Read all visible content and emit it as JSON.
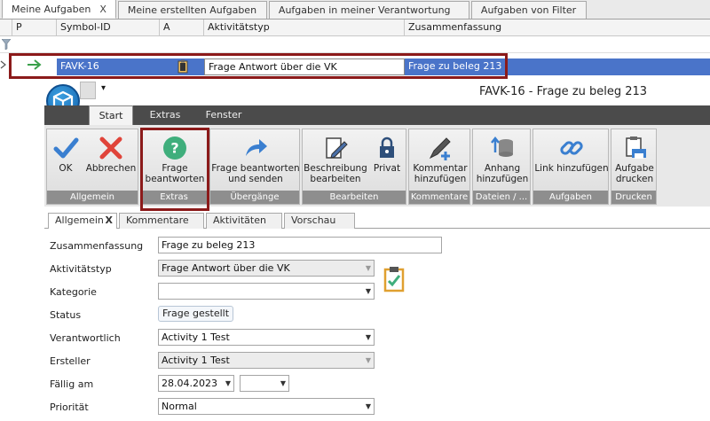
{
  "top_tabs": [
    {
      "label": "Meine Aufgaben",
      "close": "X"
    },
    {
      "label": "Meine erstellten Aufgaben"
    },
    {
      "label": "Aufgaben in meiner Verantwortung"
    },
    {
      "label": "Aufgaben von Filter"
    }
  ],
  "grid": {
    "columns": [
      "P",
      "Symbol-ID",
      "A",
      "Aktivitätstyp",
      "Zusammenfassung"
    ],
    "row": {
      "symbol_id": "FAVK-16",
      "activity_type": "Frage Antwort über die VK",
      "summary": "Frage zu beleg 213"
    }
  },
  "window": {
    "title": "FAVK-16 - Frage zu beleg 213",
    "qa_glyph": "▾"
  },
  "menu": {
    "tabs": [
      "Start",
      "Extras",
      "Fenster"
    ]
  },
  "ribbon": {
    "groups": [
      {
        "name": "Allgemein",
        "buttons": [
          [
            "OK"
          ],
          [
            "Abbrechen"
          ]
        ]
      },
      {
        "name": "Extras",
        "buttons": [
          [
            "Frage",
            "beantworten"
          ]
        ]
      },
      {
        "name": "Übergänge",
        "buttons": [
          [
            "Frage beantworten",
            "und senden"
          ]
        ]
      },
      {
        "name": "Bearbeiten",
        "buttons": [
          [
            "Beschreibung",
            "bearbeiten"
          ],
          [
            "Privat"
          ]
        ]
      },
      {
        "name": "Kommentare",
        "buttons": [
          [
            "Kommentar",
            "hinzufügen"
          ]
        ]
      },
      {
        "name": "Dateien / ...",
        "buttons": [
          [
            "Anhang",
            "hinzufügen"
          ]
        ]
      },
      {
        "name": "Aufgaben",
        "buttons": [
          [
            "Link hinzufügen"
          ]
        ]
      },
      {
        "name": "Drucken",
        "buttons": [
          [
            "Aufgabe",
            "drucken"
          ]
        ]
      }
    ]
  },
  "detail_tabs": [
    {
      "label": "Allgemein",
      "close": "X"
    },
    {
      "label": "Kommentare"
    },
    {
      "label": "Aktivitäten"
    },
    {
      "label": "Vorschau"
    }
  ],
  "form": {
    "labels": {
      "summary": "Zusammenfassung",
      "activity_type": "Aktivitätstyp",
      "category": "Kategorie",
      "status": "Status",
      "responsible": "Verantwortlich",
      "creator": "Ersteller",
      "due": "Fällig am",
      "priority": "Priorität"
    },
    "values": {
      "summary": "Frage zu beleg 213",
      "activity_type": "Frage Antwort über die VK",
      "category": "",
      "status": "Frage gestellt",
      "responsible": "Activity 1 Test",
      "creator": "Activity 1 Test",
      "due_date": "28.04.2023",
      "due_time": "",
      "priority": "Normal"
    }
  },
  "colors": {
    "selection": "#4a74c9",
    "highlight_border": "#8b1a1a",
    "menu_bar": "#4b4b4b",
    "ok_check": "#3a7fd0",
    "cancel_x": "#e0443a",
    "help_circle": "#3fae7c"
  }
}
